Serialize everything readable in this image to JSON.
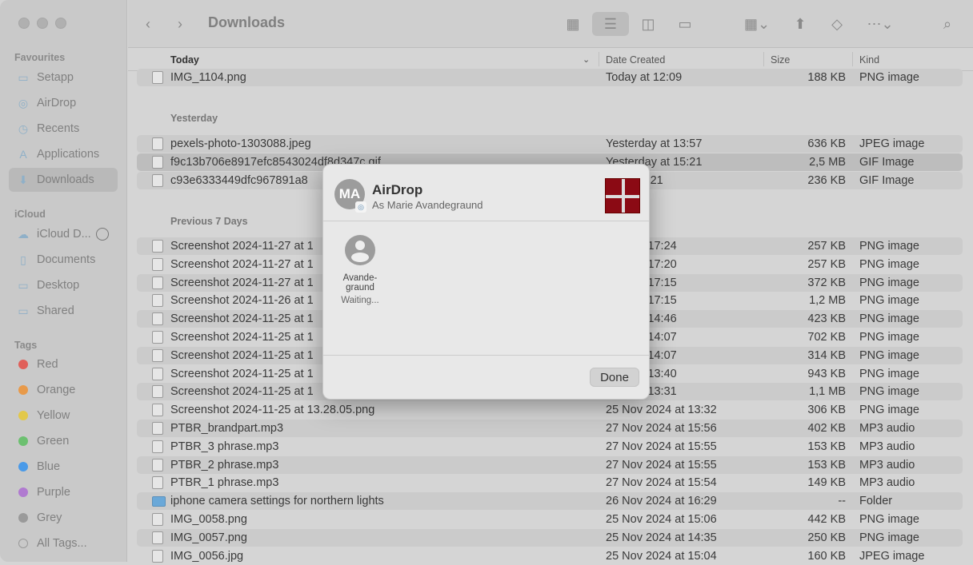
{
  "window": {
    "title": "Downloads"
  },
  "sidebar": {
    "favourites_label": "Favourites",
    "favourites": [
      {
        "label": "Setapp",
        "icon": "folder-icon"
      },
      {
        "label": "AirDrop",
        "icon": "airdrop-icon"
      },
      {
        "label": "Recents",
        "icon": "clock-icon"
      },
      {
        "label": "Applications",
        "icon": "applications-icon"
      },
      {
        "label": "Downloads",
        "icon": "download-icon",
        "selected": true
      }
    ],
    "icloud_label": "iCloud",
    "icloud": [
      {
        "label": "iCloud D...",
        "icon": "cloud-icon"
      },
      {
        "label": "Documents",
        "icon": "document-icon"
      },
      {
        "label": "Desktop",
        "icon": "desktop-icon"
      },
      {
        "label": "Shared",
        "icon": "shared-folder-icon"
      }
    ],
    "tags_label": "Tags",
    "tags": [
      {
        "label": "Red",
        "color": "#e0605a"
      },
      {
        "label": "Orange",
        "color": "#e89a4a"
      },
      {
        "label": "Yellow",
        "color": "#e2c84a"
      },
      {
        "label": "Green",
        "color": "#6cc070"
      },
      {
        "label": "Blue",
        "color": "#4a9ae8"
      },
      {
        "label": "Purple",
        "color": "#b07ad0"
      },
      {
        "label": "Grey",
        "color": "#9a9a9a"
      },
      {
        "label": "All Tags...",
        "color": ""
      }
    ]
  },
  "columns": {
    "name": "Today",
    "date": "Date Created",
    "size": "Size",
    "kind": "Kind"
  },
  "groups": [
    {
      "label": "",
      "rows": [
        {
          "name": "IMG_1104.png",
          "date": "Today at 12:09",
          "size": "188 KB",
          "kind": "PNG image"
        }
      ]
    },
    {
      "label": "Yesterday",
      "rows": [
        {
          "name": "pexels-photo-1303088.jpeg",
          "date": "Yesterday at 13:57",
          "size": "636 KB",
          "kind": "JPEG image"
        },
        {
          "name": "f9c13b706e8917efc8543024df8d347c.gif",
          "date": "Yesterday at 15:21",
          "size": "2,5 MB",
          "kind": "GIF Image",
          "selected": true
        },
        {
          "name": "c93e6333449dfc967891a8",
          "date": "ay at 15:21",
          "size": "236 KB",
          "kind": "GIF Image"
        }
      ]
    },
    {
      "label": "Previous 7 Days",
      "rows": [
        {
          "name": "Screenshot 2024-11-27 at 1",
          "date": "2024 at 17:24",
          "size": "257 KB",
          "kind": "PNG image"
        },
        {
          "name": "Screenshot 2024-11-27 at 1",
          "date": "2024 at 17:20",
          "size": "257 KB",
          "kind": "PNG image"
        },
        {
          "name": "Screenshot 2024-11-27 at 1",
          "date": "2024 at 17:15",
          "size": "372 KB",
          "kind": "PNG image"
        },
        {
          "name": "Screenshot 2024-11-26 at 1",
          "date": "2024 at 17:15",
          "size": "1,2 MB",
          "kind": "PNG image"
        },
        {
          "name": "Screenshot 2024-11-25 at 1",
          "date": "2024 at 14:46",
          "size": "423 KB",
          "kind": "PNG image"
        },
        {
          "name": "Screenshot 2024-11-25 at 1",
          "date": "2024 at 14:07",
          "size": "702 KB",
          "kind": "PNG image"
        },
        {
          "name": "Screenshot 2024-11-25 at 1",
          "date": "2024 at 14:07",
          "size": "314 KB",
          "kind": "PNG image"
        },
        {
          "name": "Screenshot 2024-11-25 at 1",
          "date": "2024 at 13:40",
          "size": "943 KB",
          "kind": "PNG image"
        },
        {
          "name": "Screenshot 2024-11-25 at 1",
          "date": "2024 at 13:31",
          "size": "1,1 MB",
          "kind": "PNG image"
        },
        {
          "name": "Screenshot 2024-11-25 at 13.28.05.png",
          "date": "25 Nov 2024 at 13:32",
          "size": "306 KB",
          "kind": "PNG image"
        },
        {
          "name": "PTBR_brandpart.mp3",
          "date": "27 Nov 2024 at 15:56",
          "size": "402 KB",
          "kind": "MP3 audio"
        },
        {
          "name": "PTBR_3 phrase.mp3",
          "date": "27 Nov 2024 at 15:55",
          "size": "153 KB",
          "kind": "MP3 audio"
        },
        {
          "name": "PTBR_2 phrase.mp3",
          "date": "27 Nov 2024 at 15:55",
          "size": "153 KB",
          "kind": "MP3 audio"
        },
        {
          "name": "PTBR_1 phrase.mp3",
          "date": "27 Nov 2024 at 15:54",
          "size": "149 KB",
          "kind": "MP3 audio"
        },
        {
          "name": "iphone camera settings for northern lights",
          "date": "26 Nov 2024 at 16:29",
          "size": "--",
          "kind": "Folder",
          "folder": true
        },
        {
          "name": "IMG_0058.png",
          "date": "25 Nov 2024 at 15:06",
          "size": "442 KB",
          "kind": "PNG image"
        },
        {
          "name": "IMG_0057.png",
          "date": "25 Nov 2024 at 14:35",
          "size": "250 KB",
          "kind": "PNG image"
        },
        {
          "name": "IMG_0056.jpg",
          "date": "25 Nov 2024 at 15:04",
          "size": "160 KB",
          "kind": "JPEG image"
        }
      ]
    }
  ],
  "dialog": {
    "title": "AirDrop",
    "subtitle": "As Marie Avandegraund",
    "initials": "MA",
    "recipient": {
      "name_line1": "Avande-",
      "name_line2": "graund",
      "status": "Waiting..."
    },
    "done_label": "Done"
  }
}
